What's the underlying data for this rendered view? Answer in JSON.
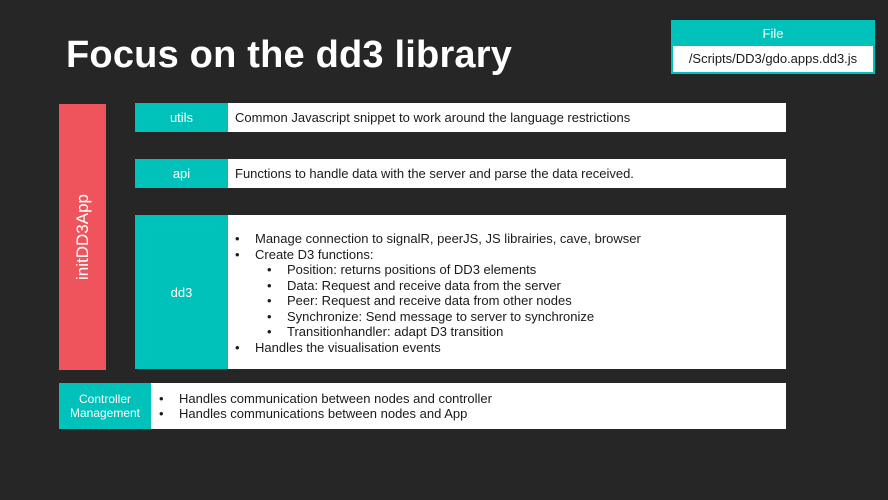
{
  "title": "Focus on the dd3 library",
  "file_box": {
    "header": "File",
    "path": "/Scripts/DD3/gdo.apps.dd3.js"
  },
  "init_bar": {
    "label": "initDD3App"
  },
  "modules": [
    {
      "label": "utils",
      "description": "Common Javascript snippet to work around the language restrictions"
    },
    {
      "label": "api",
      "description": "Functions to handle data with the server and parse the data received."
    },
    {
      "label": "dd3",
      "items": [
        "Manage connection to signalR, peerJS, JS librairies, cave, browser",
        "Create D3 functions:",
        "Handles the visualisation events"
      ],
      "subitems": [
        "Position: returns positions of DD3 elements",
        "Data: Request and receive data from the server",
        "Peer: Request and receive data from other nodes",
        "Synchronize: Send message to server to synchronize",
        "Transitionhandler: adapt D3 transition"
      ]
    }
  ],
  "controller": {
    "label_line1": "Controller",
    "label_line2": "Management",
    "items": [
      "Handles communication between nodes and controller",
      "Handles communications between nodes and App"
    ]
  }
}
